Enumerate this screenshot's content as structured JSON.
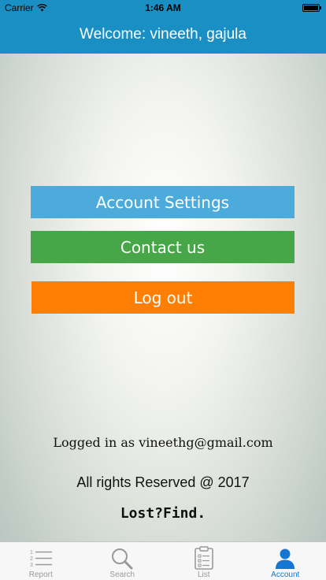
{
  "status_bar": {
    "carrier": "Carrier",
    "time": "1:46 AM"
  },
  "header": {
    "title": "Welcome: vineeth, gajula"
  },
  "actions": {
    "account_settings": "Account Settings",
    "contact_us": "Contact us",
    "log_out": "Log out"
  },
  "footer": {
    "logged_in": "Logged in as vineethg@gmail.com",
    "rights": "All rights Reserved @ 2017",
    "brand": "Lost?Find."
  },
  "tabs": [
    {
      "label": "Report",
      "icon": "numbered-list-icon",
      "active": false
    },
    {
      "label": "Search",
      "icon": "magnifier-icon",
      "active": false
    },
    {
      "label": "List",
      "icon": "clipboard-icon",
      "active": false
    },
    {
      "label": "Account",
      "icon": "person-icon",
      "active": true
    }
  ],
  "colors": {
    "header": "#1a8fc3",
    "account_settings": "#4cabdb",
    "contact_us": "#47a647",
    "log_out": "#ff7f05",
    "tab_active": "#1676d2"
  }
}
